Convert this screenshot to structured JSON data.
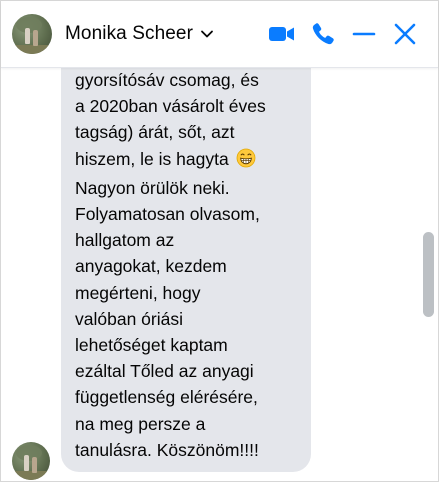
{
  "header": {
    "contact_name": "Monika Scheer",
    "icons": [
      "chevron-down-icon",
      "video-camera-icon",
      "phone-icon",
      "minimize-icon",
      "close-icon"
    ]
  },
  "message": {
    "first_line_partial": "...",
    "lines": [
      "gyorsítósáv csomag, és",
      "a 2020ban vásárolt éves",
      "tagság) árát, sőt, azt",
      "hiszem, le is hagyta",
      "Nagyon örülök neki.",
      "Folyamatosan olvasom,",
      "hallgatom az",
      "anyagokat, kezdem",
      "megérteni, hogy",
      "valóban óriási",
      "lehetőséget kaptam",
      "ezáltal Tőled az anyagi",
      "függetlenség elérésére,",
      "na meg persze a",
      "tanulásra. Köszönöm!!!!"
    ],
    "emoji": "grinning-face-icon"
  },
  "colors": {
    "accent": "#0a7cff",
    "bubble": "#e4e6eb",
    "text": "#050505",
    "scroll_thumb": "#bcc0c4"
  }
}
